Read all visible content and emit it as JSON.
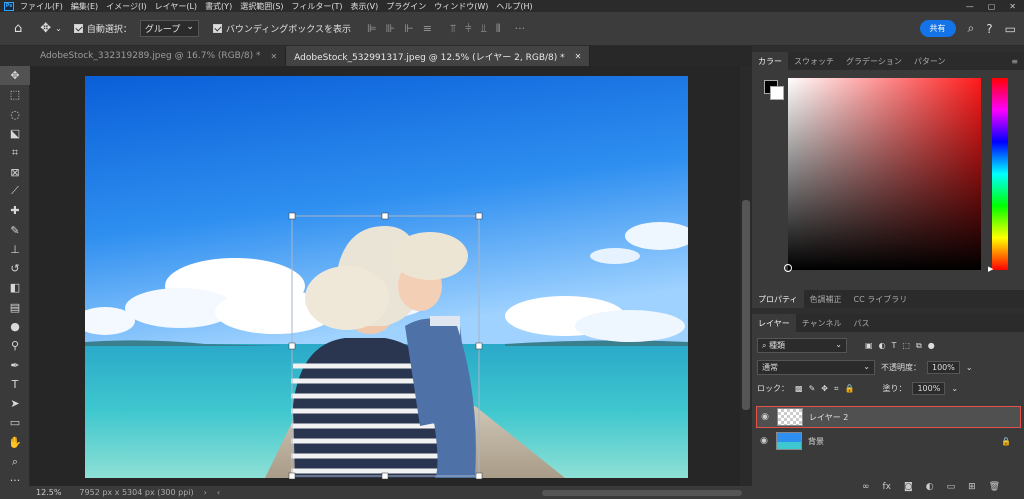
{
  "app": {
    "logo": "Ps"
  },
  "menu": [
    "ファイル(F)",
    "編集(E)",
    "イメージ(I)",
    "レイヤー(L)",
    "書式(Y)",
    "選択範囲(S)",
    "フィルター(T)",
    "表示(V)",
    "プラグイン",
    "ウィンドウ(W)",
    "ヘルプ(H)"
  ],
  "options": {
    "auto_select_label": "自動選択：",
    "auto_select_value": "グループ",
    "bounding_box_label": "バウンディングボックスを表示",
    "share_label": "共有"
  },
  "tabs": [
    {
      "label": "AdobeStock_332319289.jpeg @ 16.7% (RGB/8) *",
      "close": "✕"
    },
    {
      "label": "AdobeStock_532991317.jpeg @ 12.5% (レイヤー 2, RGB/8) *",
      "close": "✕"
    }
  ],
  "status": {
    "zoom": "12.5%",
    "doc_info": "7952 px x 5304 px (300 ppi)"
  },
  "color_panel": {
    "tabs": [
      "カラー",
      "スウォッチ",
      "グラデーション",
      "パターン"
    ],
    "hue_color": "#ff1a1a"
  },
  "props_panel": {
    "tabs": [
      "プロパティ",
      "色調補正",
      "CC ライブラリ"
    ]
  },
  "layers_panel": {
    "tabs": [
      "レイヤー",
      "チャンネル",
      "パス"
    ],
    "filter_label": "種類",
    "blend_mode": "通常",
    "opacity_label": "不透明度：",
    "opacity_value": "100%",
    "lock_label": "ロック：",
    "fill_label": "塗り：",
    "fill_value": "100%",
    "layers": [
      {
        "name": "レイヤー 2",
        "selected": true
      },
      {
        "name": "背景",
        "selected": false
      }
    ]
  }
}
